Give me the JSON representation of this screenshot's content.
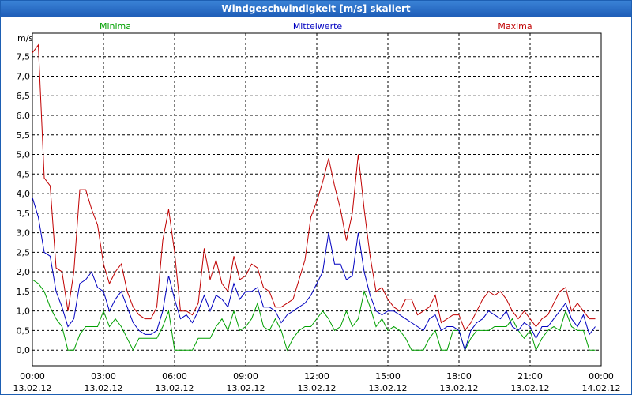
{
  "window": {
    "title": "Windgeschwindigkeit [m/s] skaliert"
  },
  "chart_data": {
    "type": "line",
    "unit_label": "m/s",
    "ylim": [
      -0.4,
      8.1
    ],
    "y_ticks": [
      0.0,
      0.5,
      1.0,
      1.5,
      2.0,
      2.5,
      3.0,
      3.5,
      4.0,
      4.5,
      5.0,
      5.5,
      6.0,
      6.5,
      7.0,
      7.5
    ],
    "y_tick_labels": [
      "0,0",
      "0,5",
      "1,0",
      "1,5",
      "2,0",
      "2,5",
      "3,0",
      "3,5",
      "4,0",
      "4,5",
      "5,0",
      "5,5",
      "6,0",
      "6,5",
      "7,0",
      "7,5"
    ],
    "x_ticks": [
      {
        "time": "00:00",
        "date": "13.02.12"
      },
      {
        "time": "03:00",
        "date": "13.02.12"
      },
      {
        "time": "06:00",
        "date": "13.02.12"
      },
      {
        "time": "09:00",
        "date": "13.02.12"
      },
      {
        "time": "12:00",
        "date": "13.02.12"
      },
      {
        "time": "15:00",
        "date": "13.02.12"
      },
      {
        "time": "18:00",
        "date": "13.02.12"
      },
      {
        "time": "21:00",
        "date": "13.02.12"
      },
      {
        "time": "00:00",
        "date": "14.02.12"
      }
    ],
    "x_hours_range": [
      0,
      24
    ],
    "grid": true,
    "series": [
      {
        "name": "Minima",
        "color": "#00a000",
        "points": [
          [
            0,
            1.8
          ],
          [
            0.25,
            1.7
          ],
          [
            0.5,
            1.5
          ],
          [
            0.75,
            1.1
          ],
          [
            1.0,
            0.8
          ],
          [
            1.25,
            0.6
          ],
          [
            1.5,
            0.0
          ],
          [
            1.75,
            0.0
          ],
          [
            2.0,
            0.4
          ],
          [
            2.25,
            0.6
          ],
          [
            2.5,
            0.6
          ],
          [
            2.75,
            0.6
          ],
          [
            3.0,
            1.0
          ],
          [
            3.25,
            0.6
          ],
          [
            3.5,
            0.8
          ],
          [
            3.75,
            0.6
          ],
          [
            4.0,
            0.3
          ],
          [
            4.25,
            0.0
          ],
          [
            4.5,
            0.3
          ],
          [
            4.75,
            0.3
          ],
          [
            5.0,
            0.3
          ],
          [
            5.25,
            0.3
          ],
          [
            5.5,
            0.6
          ],
          [
            5.75,
            1.0
          ],
          [
            6.0,
            0.0
          ],
          [
            6.25,
            0.0
          ],
          [
            6.5,
            0.0
          ],
          [
            6.75,
            0.0
          ],
          [
            7.0,
            0.3
          ],
          [
            7.25,
            0.3
          ],
          [
            7.5,
            0.3
          ],
          [
            7.75,
            0.6
          ],
          [
            8.0,
            0.8
          ],
          [
            8.25,
            0.5
          ],
          [
            8.5,
            1.0
          ],
          [
            8.75,
            0.5
          ],
          [
            9.0,
            0.6
          ],
          [
            9.25,
            0.8
          ],
          [
            9.5,
            1.2
          ],
          [
            9.75,
            0.6
          ],
          [
            10.0,
            0.5
          ],
          [
            10.25,
            0.8
          ],
          [
            10.5,
            0.5
          ],
          [
            10.75,
            0.0
          ],
          [
            11.0,
            0.3
          ],
          [
            11.25,
            0.5
          ],
          [
            11.5,
            0.6
          ],
          [
            11.75,
            0.6
          ],
          [
            12.0,
            0.8
          ],
          [
            12.25,
            1.0
          ],
          [
            12.5,
            0.8
          ],
          [
            12.75,
            0.5
          ],
          [
            13.0,
            0.6
          ],
          [
            13.25,
            1.0
          ],
          [
            13.5,
            0.6
          ],
          [
            13.75,
            0.8
          ],
          [
            14.0,
            1.5
          ],
          [
            14.25,
            1.1
          ],
          [
            14.5,
            0.6
          ],
          [
            14.75,
            0.8
          ],
          [
            15.0,
            0.5
          ],
          [
            15.25,
            0.6
          ],
          [
            15.5,
            0.5
          ],
          [
            15.75,
            0.3
          ],
          [
            16.0,
            0.0
          ],
          [
            16.25,
            0.0
          ],
          [
            16.5,
            0.0
          ],
          [
            16.75,
            0.3
          ],
          [
            17.0,
            0.5
          ],
          [
            17.25,
            0.0
          ],
          [
            17.5,
            0.0
          ],
          [
            17.75,
            0.5
          ],
          [
            18.0,
            0.5
          ],
          [
            18.25,
            0.0
          ],
          [
            18.5,
            0.3
          ],
          [
            18.75,
            0.5
          ],
          [
            19.0,
            0.5
          ],
          [
            19.25,
            0.5
          ],
          [
            19.5,
            0.6
          ],
          [
            19.75,
            0.6
          ],
          [
            20.0,
            0.6
          ],
          [
            20.25,
            0.8
          ],
          [
            20.5,
            0.5
          ],
          [
            20.75,
            0.3
          ],
          [
            21.0,
            0.5
          ],
          [
            21.25,
            0.0
          ],
          [
            21.5,
            0.3
          ],
          [
            21.75,
            0.5
          ],
          [
            22.0,
            0.6
          ],
          [
            22.25,
            0.5
          ],
          [
            22.5,
            1.0
          ],
          [
            22.75,
            0.6
          ],
          [
            23.0,
            0.5
          ],
          [
            23.25,
            0.5
          ],
          [
            23.5,
            0.0
          ],
          [
            23.75,
            0.0
          ]
        ]
      },
      {
        "name": "Mittelwerte",
        "color": "#0000c0",
        "points": [
          [
            0,
            3.9
          ],
          [
            0.25,
            3.4
          ],
          [
            0.5,
            2.5
          ],
          [
            0.75,
            2.4
          ],
          [
            1.0,
            1.5
          ],
          [
            1.25,
            1.1
          ],
          [
            1.5,
            0.6
          ],
          [
            1.75,
            0.8
          ],
          [
            2.0,
            1.7
          ],
          [
            2.25,
            1.8
          ],
          [
            2.5,
            2.0
          ],
          [
            2.75,
            1.6
          ],
          [
            3.0,
            1.5
          ],
          [
            3.25,
            1.0
          ],
          [
            3.5,
            1.3
          ],
          [
            3.75,
            1.5
          ],
          [
            4.0,
            1.1
          ],
          [
            4.25,
            0.7
          ],
          [
            4.5,
            0.5
          ],
          [
            4.75,
            0.4
          ],
          [
            5.0,
            0.4
          ],
          [
            5.25,
            0.5
          ],
          [
            5.5,
            1.0
          ],
          [
            5.75,
            1.9
          ],
          [
            6.0,
            1.3
          ],
          [
            6.25,
            0.8
          ],
          [
            6.5,
            0.9
          ],
          [
            6.75,
            0.7
          ],
          [
            7.0,
            1.0
          ],
          [
            7.25,
            1.4
          ],
          [
            7.5,
            1.0
          ],
          [
            7.75,
            1.4
          ],
          [
            8.0,
            1.3
          ],
          [
            8.25,
            1.1
          ],
          [
            8.5,
            1.7
          ],
          [
            8.75,
            1.3
          ],
          [
            9.0,
            1.5
          ],
          [
            9.25,
            1.5
          ],
          [
            9.5,
            1.6
          ],
          [
            9.75,
            1.1
          ],
          [
            10.0,
            1.1
          ],
          [
            10.25,
            1.0
          ],
          [
            10.5,
            0.7
          ],
          [
            10.75,
            0.9
          ],
          [
            11.0,
            1.0
          ],
          [
            11.25,
            1.1
          ],
          [
            11.5,
            1.2
          ],
          [
            11.75,
            1.4
          ],
          [
            12.0,
            1.7
          ],
          [
            12.25,
            2.0
          ],
          [
            12.5,
            3.0
          ],
          [
            12.75,
            2.2
          ],
          [
            13.0,
            2.2
          ],
          [
            13.25,
            1.8
          ],
          [
            13.5,
            1.9
          ],
          [
            13.75,
            3.0
          ],
          [
            14.0,
            2.0
          ],
          [
            14.25,
            1.4
          ],
          [
            14.5,
            1.0
          ],
          [
            14.75,
            0.9
          ],
          [
            15.0,
            1.0
          ],
          [
            15.25,
            1.0
          ],
          [
            15.5,
            0.9
          ],
          [
            15.75,
            0.8
          ],
          [
            16.0,
            0.7
          ],
          [
            16.25,
            0.6
          ],
          [
            16.5,
            0.5
          ],
          [
            16.75,
            0.8
          ],
          [
            17.0,
            0.9
          ],
          [
            17.25,
            0.5
          ],
          [
            17.5,
            0.6
          ],
          [
            17.75,
            0.6
          ],
          [
            18.0,
            0.5
          ],
          [
            18.25,
            0.0
          ],
          [
            18.5,
            0.5
          ],
          [
            18.75,
            0.7
          ],
          [
            19.0,
            0.8
          ],
          [
            19.25,
            1.0
          ],
          [
            19.5,
            0.9
          ],
          [
            19.75,
            0.8
          ],
          [
            20.0,
            1.0
          ],
          [
            20.25,
            0.6
          ],
          [
            20.5,
            0.5
          ],
          [
            20.75,
            0.7
          ],
          [
            21.0,
            0.6
          ],
          [
            21.25,
            0.3
          ],
          [
            21.5,
            0.6
          ],
          [
            21.75,
            0.6
          ],
          [
            22.0,
            0.8
          ],
          [
            22.25,
            1.0
          ],
          [
            22.5,
            1.2
          ],
          [
            22.75,
            0.8
          ],
          [
            23.0,
            0.6
          ],
          [
            23.25,
            0.9
          ],
          [
            23.5,
            0.4
          ],
          [
            23.75,
            0.6
          ]
        ]
      },
      {
        "name": "Maxima",
        "color": "#c00000",
        "points": [
          [
            0,
            7.6
          ],
          [
            0.25,
            7.8
          ],
          [
            0.5,
            4.4
          ],
          [
            0.75,
            4.2
          ],
          [
            1.0,
            2.1
          ],
          [
            1.25,
            2.0
          ],
          [
            1.5,
            1.0
          ],
          [
            1.75,
            2.0
          ],
          [
            2.0,
            4.1
          ],
          [
            2.25,
            4.1
          ],
          [
            2.5,
            3.6
          ],
          [
            2.75,
            3.2
          ],
          [
            3.0,
            2.2
          ],
          [
            3.25,
            1.7
          ],
          [
            3.5,
            2.0
          ],
          [
            3.75,
            2.2
          ],
          [
            4.0,
            1.5
          ],
          [
            4.25,
            1.1
          ],
          [
            4.5,
            0.9
          ],
          [
            4.75,
            0.8
          ],
          [
            5.0,
            0.8
          ],
          [
            5.25,
            1.1
          ],
          [
            5.5,
            2.8
          ],
          [
            5.75,
            3.6
          ],
          [
            6.0,
            2.5
          ],
          [
            6.25,
            1.0
          ],
          [
            6.5,
            1.0
          ],
          [
            6.75,
            0.9
          ],
          [
            7.0,
            1.2
          ],
          [
            7.25,
            2.6
          ],
          [
            7.5,
            1.8
          ],
          [
            7.75,
            2.3
          ],
          [
            8.0,
            1.7
          ],
          [
            8.25,
            1.5
          ],
          [
            8.5,
            2.4
          ],
          [
            8.75,
            1.8
          ],
          [
            9.0,
            1.9
          ],
          [
            9.25,
            2.2
          ],
          [
            9.5,
            2.1
          ],
          [
            9.75,
            1.6
          ],
          [
            10.0,
            1.5
          ],
          [
            10.25,
            1.1
          ],
          [
            10.5,
            1.1
          ],
          [
            10.75,
            1.2
          ],
          [
            11.0,
            1.3
          ],
          [
            11.25,
            1.8
          ],
          [
            11.5,
            2.3
          ],
          [
            11.75,
            3.4
          ],
          [
            12.0,
            3.8
          ],
          [
            12.25,
            4.3
          ],
          [
            12.5,
            4.9
          ],
          [
            12.75,
            4.2
          ],
          [
            13.0,
            3.6
          ],
          [
            13.25,
            2.8
          ],
          [
            13.5,
            3.5
          ],
          [
            13.75,
            5.0
          ],
          [
            14.0,
            3.6
          ],
          [
            14.25,
            2.4
          ],
          [
            14.5,
            1.5
          ],
          [
            14.75,
            1.6
          ],
          [
            15.0,
            1.3
          ],
          [
            15.25,
            1.1
          ],
          [
            15.5,
            1.0
          ],
          [
            15.75,
            1.3
          ],
          [
            16.0,
            1.3
          ],
          [
            16.25,
            0.9
          ],
          [
            16.5,
            1.0
          ],
          [
            16.75,
            1.1
          ],
          [
            17.0,
            1.4
          ],
          [
            17.25,
            0.7
          ],
          [
            17.5,
            0.8
          ],
          [
            17.75,
            0.9
          ],
          [
            18.0,
            0.9
          ],
          [
            18.25,
            0.5
          ],
          [
            18.5,
            0.7
          ],
          [
            18.75,
            1.0
          ],
          [
            19.0,
            1.3
          ],
          [
            19.25,
            1.5
          ],
          [
            19.5,
            1.4
          ],
          [
            19.75,
            1.5
          ],
          [
            20.0,
            1.3
          ],
          [
            20.25,
            1.0
          ],
          [
            20.5,
            0.8
          ],
          [
            20.75,
            1.0
          ],
          [
            21.0,
            0.8
          ],
          [
            21.25,
            0.6
          ],
          [
            21.5,
            0.8
          ],
          [
            21.75,
            0.9
          ],
          [
            22.0,
            1.2
          ],
          [
            22.25,
            1.5
          ],
          [
            22.5,
            1.6
          ],
          [
            22.75,
            1.0
          ],
          [
            23.0,
            1.2
          ],
          [
            23.25,
            1.0
          ],
          [
            23.5,
            0.8
          ],
          [
            23.75,
            0.8
          ]
        ]
      }
    ]
  }
}
